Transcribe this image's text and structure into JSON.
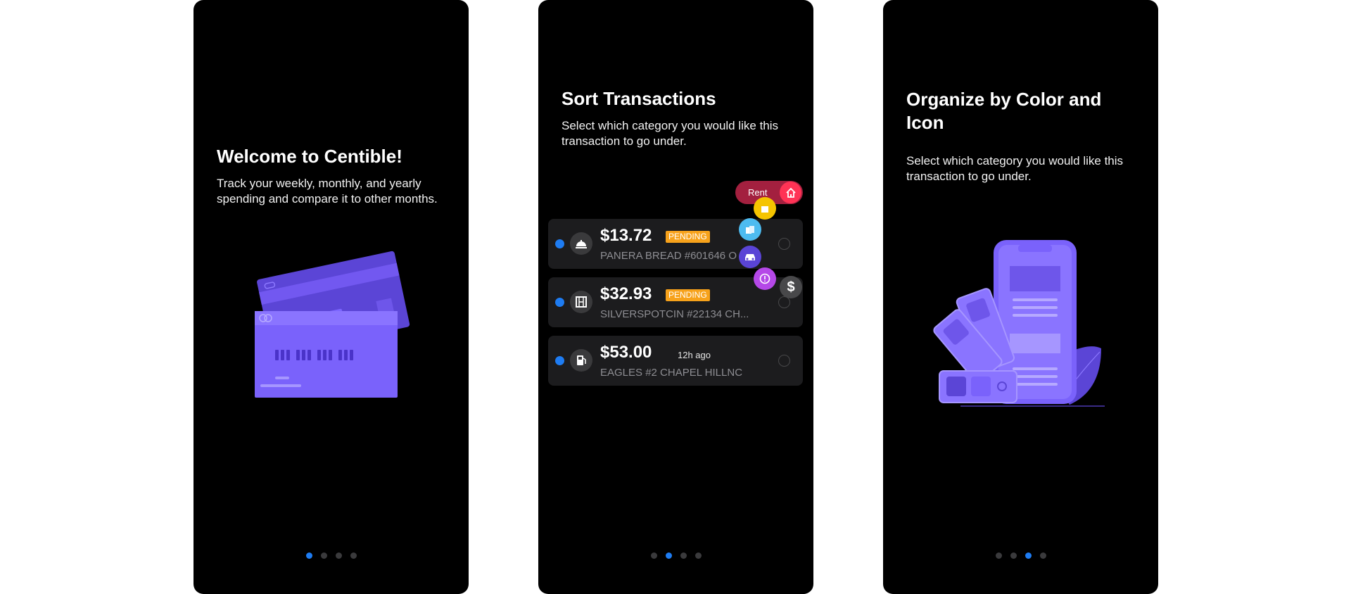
{
  "screens": [
    {
      "title": "Welcome to Centible!",
      "subtitle": "Track your weekly, monthly, and yearly spending and compare it to other months.",
      "active_dot": 0
    },
    {
      "title": "Sort Transactions",
      "subtitle": "Select which category you would like this transaction to go under.",
      "active_dot": 1,
      "category_popup": {
        "rent_label": "Rent"
      },
      "transactions": [
        {
          "amount": "$13.72",
          "status": "PENDING",
          "merchant": "PANERA BREAD #601646 O",
          "icon": "restaurant-bell-icon"
        },
        {
          "amount": "$32.93",
          "status": "PENDING",
          "merchant": "SILVERSPOTCIN #22134 CH...",
          "icon": "film-icon"
        },
        {
          "amount": "$53.00",
          "time": "12h ago",
          "merchant": "EAGLES #2 CHAPEL HILLNC",
          "icon": "gas-pump-icon"
        }
      ]
    },
    {
      "title": "Organize by Color and Icon",
      "subtitle": "Select which category you would like this transaction to go under.",
      "active_dot": 2
    }
  ],
  "page_dot_count": 4,
  "colors": {
    "accent": "#1e7cf2",
    "pending": "#f7a21b",
    "purple": "#7b61ff",
    "rent": "#a3203f"
  }
}
